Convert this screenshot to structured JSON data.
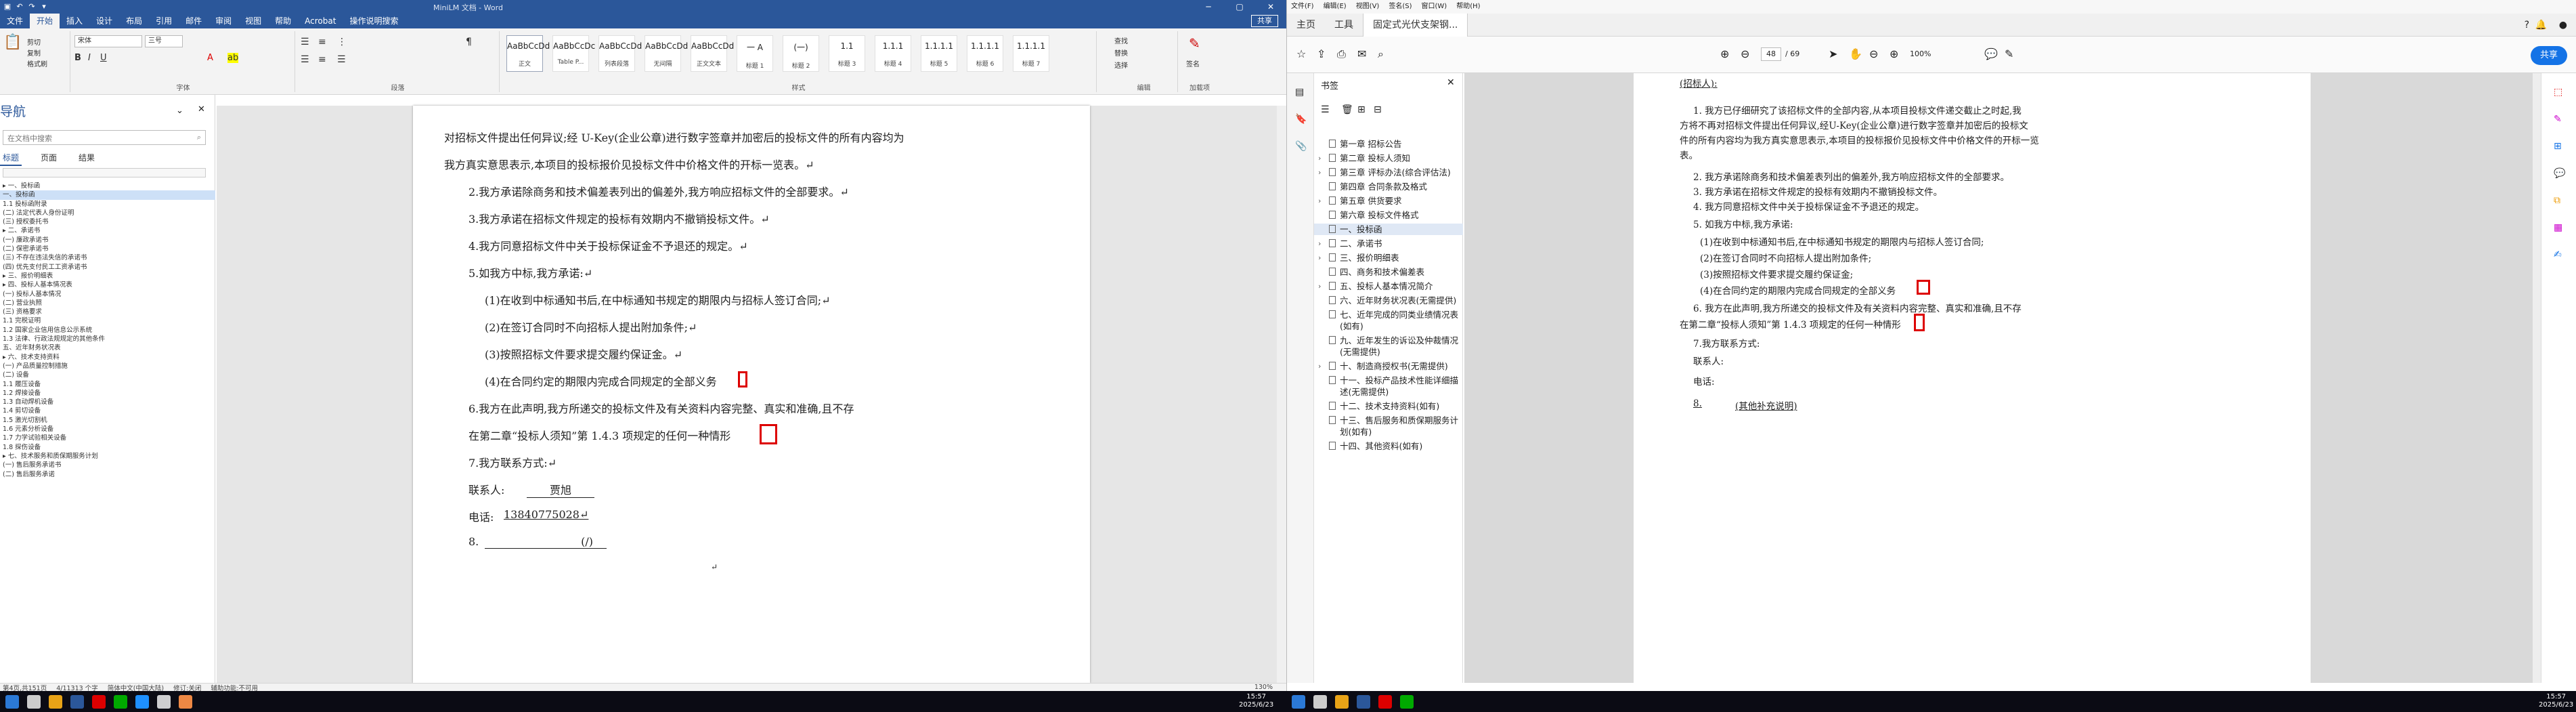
{
  "word": {
    "title_doc": "MiniLM 文档 - Word",
    "quick_access": [
      "save-icon",
      "undo-icon",
      "redo-icon",
      "customize-icon"
    ],
    "share_label": "共享",
    "tabs": [
      "文件",
      "开始",
      "插入",
      "设计",
      "布局",
      "引用",
      "邮件",
      "审阅",
      "视图",
      "帮助",
      "Acrobat",
      "操作说明搜索"
    ],
    "active_tab": "开始",
    "ribbon": {
      "clipboard": [
        "剪切",
        "复制",
        "格式刷"
      ],
      "font_name": "宋体",
      "font_size": "三号",
      "group_font": "字体",
      "group_paragraph": "段落",
      "group_styles": "样式",
      "group_edit": [
        "查找",
        "替换",
        "选择"
      ],
      "group_edit_label": "编辑",
      "acrobat_label": "加载项",
      "sign_label": "签名",
      "styles": [
        {
          "preview": "AaBbCcDd",
          "name": "正文"
        },
        {
          "preview": "AaBbCcDc",
          "name": "Table P..."
        },
        {
          "preview": "AaBbCcDd",
          "name": "列表段落"
        },
        {
          "preview": "AaBbCcDd",
          "name": "无间隔"
        },
        {
          "preview": "AaBbCcDd",
          "name": "正文文本"
        },
        {
          "preview": "一 A",
          "name": "标题 1"
        },
        {
          "preview": "(一)",
          "name": "标题 2"
        },
        {
          "preview": "1.1",
          "name": "标题 3"
        },
        {
          "preview": "1.1.1",
          "name": "标题 4"
        },
        {
          "preview": "1.1.1.1",
          "name": "标题 5"
        },
        {
          "preview": "1.1.1.1",
          "name": "标题 6"
        },
        {
          "preview": "1.1.1.1",
          "name": "标题 7"
        }
      ]
    },
    "nav": {
      "title": "导航",
      "search_placeholder": "在文档中搜索",
      "tabs": [
        "标题",
        "页面",
        "结果"
      ],
      "items": [
        "▸ 一、投标函",
        "  一、投标函",
        "     1.1 投标函附录",
        "  (二) 法定代表人身份证明",
        "  (三) 授权委托书",
        "▸ 二、承诺书",
        "  (一) 廉政承诺书",
        "  (二) 保密承诺书",
        "  (三) 不存在违法失信的承诺书",
        "  (四) 优先支付民工工资承诺书",
        "▸ 三、报价明细表",
        "▸ 四、投标人基本情况表",
        "  (一) 投标人基本情况",
        "  (二) 营业执照",
        "  (三) 资格要求",
        "     1.1 完税证明",
        "     1.2 国家企业信用信息公示系统",
        "     1.3 法律、行政法规规定的其他条件",
        "  五、近年财务状况表",
        "▸ 六、技术支持资料",
        "  (一) 产品质量控制措施",
        "  (二) 设备",
        "     1.1 履压设备",
        "     1.2 焊接设备",
        "     1.3 自动焊机设备",
        "     1.4 剪切设备",
        "     1.5 激光切割机",
        "     1.6 元素分析设备",
        "     1.7 力学试验相关设备",
        "     1.8 探伤设备",
        "▸ 七、技术服务和质保期服务计划",
        "  (一) 售后服务承诺书",
        "  (二) 售后服务承诺"
      ],
      "selected_index": 1
    },
    "body_lines": [
      "对招标文件提出任何异议;经 U-Key(企业公章)进行数字签章并加密后的投标文件的所有内容均为",
      "我方真实意思表示,本项目的投标报价见投标文件中价格文件的开标一览表。↵",
      "2.我方承诺除商务和技术偏差表列出的偏差外,我方响应招标文件的全部要求。↵",
      "3.我方承诺在招标文件规定的投标有效期内不撤销投标文件。↵",
      "4.我方同意招标文件中关于投标保证金不予退还的规定。↵",
      "5.如我方中标,我方承诺:↵",
      "(1)在收到中标通知书后,在中标通知书规定的期限内与招标人签订合同;↵",
      "(2)在签订合同时不向招标人提出附加条件;↵",
      "(3)按照招标文件要求提交履约保证金。↵",
      "(4)在合同约定的期限内完成合同规定的全部义务",
      "6.我方在此声明,我方所递交的投标文件及有关资料内容完整、真实和准确,且不存",
      "在第二章“投标人须知”第 1.4.3 项规定的任何一种情形",
      "7.我方联系方式:↵",
      "联系人:",
      "贾旭",
      "电话:",
      "13840775028↵",
      "8.",
      "(/)",
      "↵"
    ],
    "status": {
      "page": "第4页,共151页",
      "words": "4/11313 个字",
      "lang": "简体中文(中国大陆)",
      "mode": "修订:关闭",
      "access": "辅助功能:不可用",
      "zoom": "130%"
    }
  },
  "pdf": {
    "menu": [
      "文件(F)",
      "编辑(E)",
      "视图(V)",
      "签名(S)",
      "窗口(W)",
      "帮助(H)"
    ],
    "tabs": [
      "主页",
      "工具",
      "固定式光伏支架钢..."
    ],
    "page_current": "48",
    "page_total": "/ 69",
    "zoom": "100%",
    "share_label": "共享",
    "bookmark_title": "书签",
    "bookmarks": [
      {
        "label": "第一章 招标公告",
        "exp": ""
      },
      {
        "label": "第二章 投标人须知",
        "exp": "›"
      },
      {
        "label": "第三章 评标办法(综合评估法)",
        "exp": "›"
      },
      {
        "label": "第四章 合同条款及格式",
        "exp": ""
      },
      {
        "label": "第五章 供货要求",
        "exp": "›"
      },
      {
        "label": "第六章 投标文件格式",
        "exp": ""
      },
      {
        "label": "一、投标函",
        "exp": "",
        "sel": true
      },
      {
        "label": "二、承诺书",
        "exp": "›"
      },
      {
        "label": "三、报价明细表",
        "exp": "›"
      },
      {
        "label": "四、商务和技术偏差表",
        "exp": ""
      },
      {
        "label": "五、投标人基本情况简介",
        "exp": "›"
      },
      {
        "label": "六、近年财务状况表(无需提供)",
        "exp": ""
      },
      {
        "label": "七、近年完成的同类业绩情况表(如有)",
        "exp": ""
      },
      {
        "label": "九、近年发生的诉讼及仲裁情况(无需提供)",
        "exp": ""
      },
      {
        "label": "十、制造商授权书(无需提供)",
        "exp": "›"
      },
      {
        "label": "十一、投标产品技术性能详细描述(无需提供)",
        "exp": ""
      },
      {
        "label": "十二、技术支持资料(如有)",
        "exp": ""
      },
      {
        "label": "十三、售后服务和质保期服务计划(如有)",
        "exp": ""
      },
      {
        "label": "十四、其他资料(如有)",
        "exp": ""
      }
    ],
    "lines": [
      "(招标人):",
      "1. 我方已仔细研究了该招标文件的全部内容,从本项目投标文件递交截止之时起,我",
      "方将不再对招标文件提出任何异议,经U-Key(企业公章)进行数字签章并加密后的投标文",
      "件的所有内容均为我方真实意思表示,本项目的投标报价见投标文件中价格文件的开标一览",
      "表。",
      "2. 我方承诺除商务和技术偏差表列出的偏差外,我方响应招标文件的全部要求。",
      "3. 我方承诺在招标文件规定的投标有效期内不撤销投标文件。",
      "4. 我方同意招标文件中关于投标保证金不予退还的规定。",
      "5. 如我方中标,我方承诺:",
      "(1)在收到中标通知书后,在中标通知书规定的期限内与招标人签订合同;",
      "(2)在签订合同时不向招标人提出附加条件;",
      "(3)按照招标文件要求提交履约保证金;",
      "(4)在合同约定的期限内完成合同规定的全部义务",
      "6. 我方在此声明,我方所递交的投标文件及有关资料内容完整、真实和准确,且不存",
      "在第二章“投标人须知”第 1.4.3 项规定的任何一种情形",
      "7.我方联系方式:",
      "联系人:",
      "电话:",
      "8.",
      "(其他补充说明)"
    ]
  },
  "taskbar": {
    "clock_left_time": "15:57",
    "clock_left_date": "2025/6/23",
    "clock_right_time": "15:57",
    "clock_right_date": "2025/6/23"
  }
}
